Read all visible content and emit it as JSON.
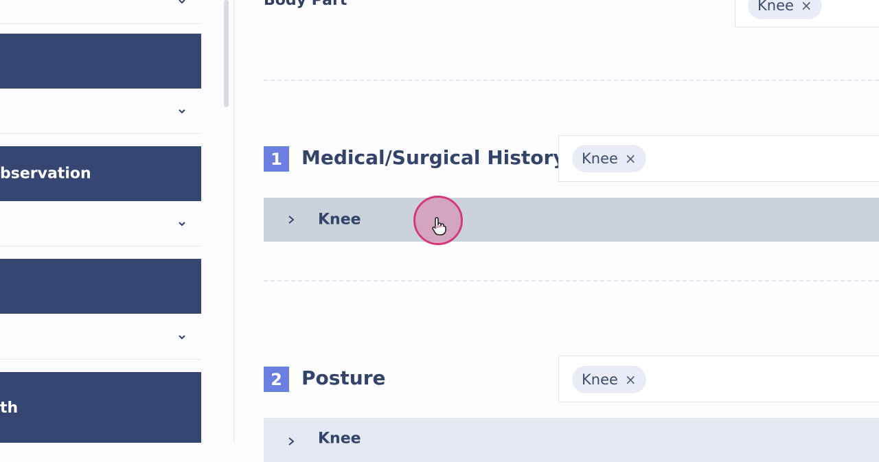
{
  "sidebar": {
    "blocks": [
      {
        "label": ""
      },
      {
        "label": "bservation"
      },
      {
        "label": ""
      },
      {
        "label": "th"
      }
    ]
  },
  "top_section": {
    "title": "Body Part",
    "chip": "Knee",
    "chip_remove": "×"
  },
  "sections": [
    {
      "number": "1",
      "title": "Medical/Surgical History",
      "chip": "Knee",
      "chip_remove": "×",
      "row_label": "Knee"
    },
    {
      "number": "2",
      "title": "Posture",
      "chip": "Knee",
      "chip_remove": "×",
      "row_label": "Knee"
    }
  ],
  "icons": {
    "sidebar_chevron": "chevron-down-icon",
    "row_chevron": "chevron-right-icon",
    "cursor": "hand-pointer-icon"
  },
  "colors": {
    "sidebar_block": "#354673",
    "number_badge": "#6b7fe0",
    "row_active": "#cbd2da",
    "row_idle": "#e4e8f3",
    "chip_bg": "#e9ecf6",
    "cursor_ring": "#d4397c"
  }
}
